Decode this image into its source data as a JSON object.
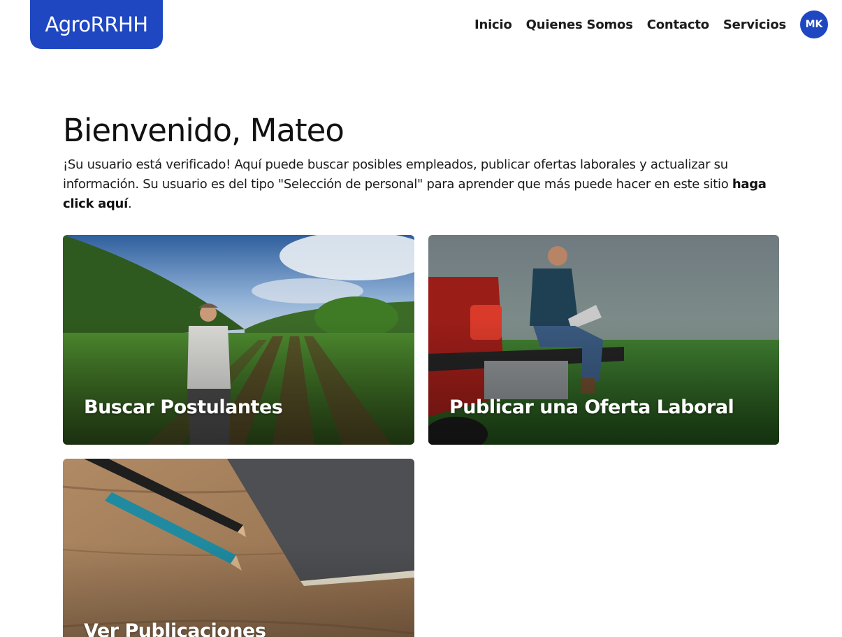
{
  "header": {
    "logo": "AgroRRHH",
    "nav": [
      "Inicio",
      "Quienes Somos",
      "Contacto",
      "Servicios"
    ],
    "avatar_initials": "MK"
  },
  "welcome": {
    "title": "Bienvenido, Mateo",
    "text": "¡Su usuario está verificado! Aquí puede buscar posibles empleados, publicar ofertas laborales y actualizar su información. Su usuario es del tipo \"Selección de personal\" para aprender que más puede hacer en este sitio ",
    "link": "haga click aquí",
    "after_link": "."
  },
  "cards": [
    {
      "title": "Buscar Postulantes",
      "image": "farmer-in-corn-field"
    },
    {
      "title": "Publicar una Oferta Laboral",
      "image": "man-with-laptop-on-pickup-truck"
    },
    {
      "title": "Ver Publicaciones",
      "image": "pencils-and-notebook-on-wood"
    }
  ],
  "colors": {
    "brand": "#1f47c2"
  }
}
